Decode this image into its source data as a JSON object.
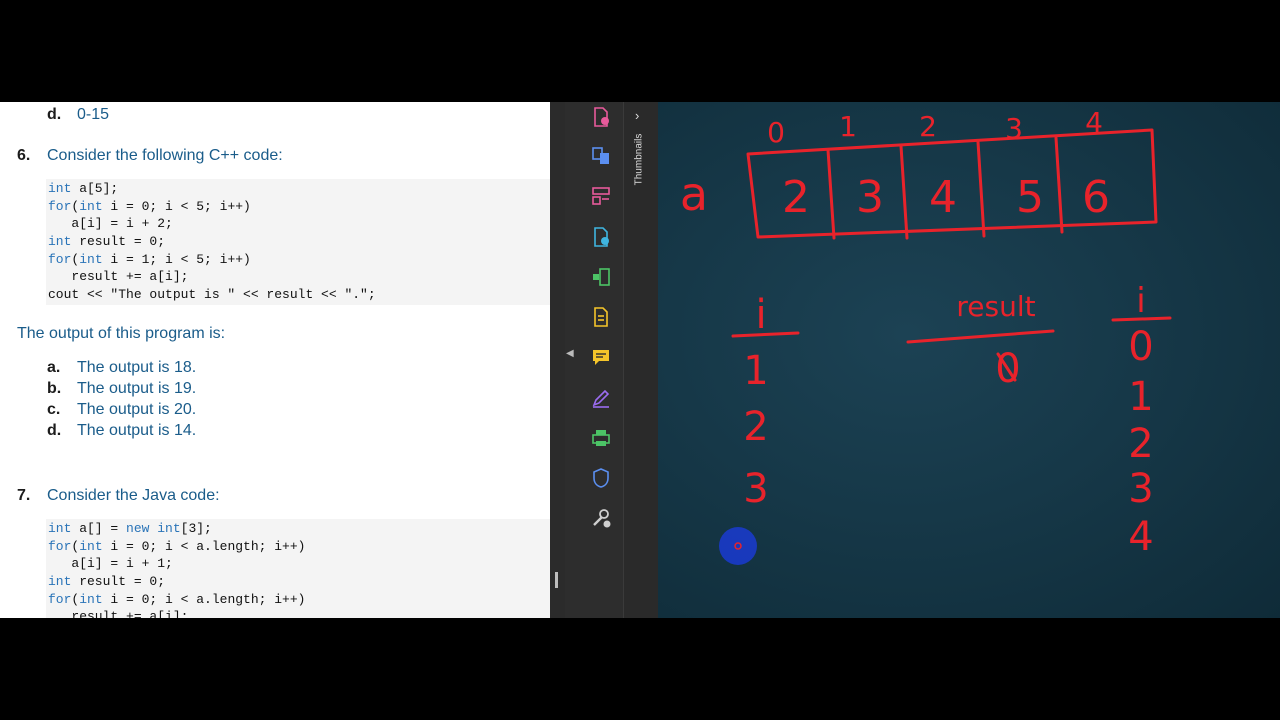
{
  "document": {
    "prev_option": {
      "key": "d.",
      "text": "0-15"
    },
    "q6": {
      "number": "6.",
      "prompt": "Consider the following C++ code:",
      "code": [
        {
          "kw": "int",
          "rest": " a[5];"
        },
        {
          "kw": "for",
          "rest": "(",
          "kw2": "int",
          "rest2": " i = 0; i < 5; i++)"
        },
        {
          "plain": "   a[i] = i + 2;"
        },
        {
          "kw": "int",
          "rest": " result = 0;"
        },
        {
          "kw": "for",
          "rest": "(",
          "kw2": "int",
          "rest2": " i = 1; i < 5; i++)"
        },
        {
          "plain": "   result += a[i];"
        },
        {
          "plain": "cout << \"The output is \" << result << \".\";"
        }
      ],
      "output_prompt": "The output of this program is:",
      "options": [
        {
          "key": "a.",
          "text": "The output is 18."
        },
        {
          "key": "b.",
          "text": "The output is 19."
        },
        {
          "key": "c.",
          "text": "The output is 20."
        },
        {
          "key": "d.",
          "text": "The output is 14."
        }
      ]
    },
    "q7": {
      "number": "7.",
      "prompt": "Consider the Java code:",
      "code": [
        {
          "kw": "int",
          "rest": " a[] = ",
          "kw2": "new",
          "mid": " ",
          "kw3": "int",
          "rest2": "[3];"
        },
        {
          "kw": "for",
          "rest": "(",
          "kw2": "int",
          "rest2": " i = 0; i < a.length; i++)"
        },
        {
          "plain": "   a[i] = i + 1;"
        },
        {
          "kw": "int",
          "rest": " result = 0;"
        },
        {
          "kw": "for",
          "rest": "(",
          "kw2": "int",
          "rest2": " i = 0; i < a.length; i++)"
        },
        {
          "plain": "   result += a[i];"
        }
      ]
    }
  },
  "thumbnails_panel": {
    "label": "Thumbnails"
  },
  "tools": [
    "pdf-export-icon",
    "combine-files-icon",
    "organize-pages-icon",
    "create-pdf-icon",
    "compress-icon",
    "edit-pdf-icon",
    "comment-icon",
    "fill-sign-icon",
    "print-production-icon",
    "protect-icon",
    "more-tools-icon"
  ],
  "chalkboard": {
    "array_name": "a",
    "indices": [
      "0",
      "1",
      "2",
      "3",
      "4"
    ],
    "values": [
      "2",
      "3",
      "4",
      "5",
      "6"
    ],
    "left_column": {
      "header": "i",
      "values": [
        "1",
        "2",
        "3"
      ]
    },
    "middle_column": {
      "header": "result",
      "values": [
        "0"
      ]
    },
    "right_column": {
      "header": "i",
      "values": [
        "0",
        "1",
        "2",
        "3",
        "4"
      ]
    },
    "ink_color": "#e8232b"
  }
}
